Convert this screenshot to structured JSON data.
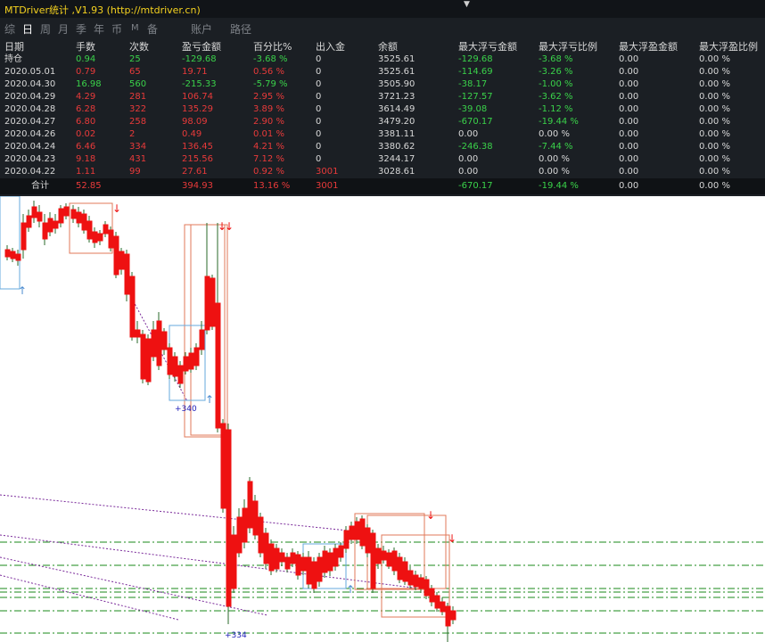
{
  "title": "MTDriver统计 ,V1.93 (http://mtdriver.cn)",
  "nav": {
    "tabs": [
      {
        "label": "综",
        "active": false
      },
      {
        "label": "日",
        "active": true
      },
      {
        "label": "周",
        "active": false
      },
      {
        "label": "月",
        "active": false
      },
      {
        "label": "季",
        "active": false
      },
      {
        "label": "年",
        "active": false
      },
      {
        "label": "币",
        "active": false
      },
      {
        "label": "M",
        "active": false
      },
      {
        "label": "备",
        "active": false
      },
      {
        "label": "账户",
        "active": false
      },
      {
        "label": "路径",
        "active": false
      }
    ]
  },
  "table": {
    "headers": [
      "日期",
      "手数",
      "次数",
      "盈亏金额",
      "百分比%",
      "出入金",
      "余额",
      "最大浮亏金额",
      "最大浮亏比例",
      "最大浮盈金额",
      "最大浮盈比例"
    ],
    "rows": [
      {
        "cells": [
          "持仓",
          "0.94",
          "25",
          "-129.68",
          "-3.68 %",
          "0",
          "3525.61",
          "-129.68",
          "-3.68 %",
          "0.00",
          "0.00 %"
        ],
        "tone": "g"
      },
      {
        "cells": [
          "2020.05.01",
          "0.79",
          "65",
          "19.71",
          "0.56 %",
          "0",
          "3525.61",
          "-114.69",
          "-3.26 %",
          "0.00",
          "0.00 %"
        ],
        "tone": "r"
      },
      {
        "cells": [
          "2020.04.30",
          "16.98",
          "560",
          "-215.33",
          "-5.79 %",
          "0",
          "3505.90",
          "-38.17",
          "-1.00 %",
          "0.00",
          "0.00 %"
        ],
        "tone": "g"
      },
      {
        "cells": [
          "2020.04.29",
          "4.29",
          "281",
          "106.74",
          "2.95 %",
          "0",
          "3721.23",
          "-127.57",
          "-3.62 %",
          "0.00",
          "0.00 %"
        ],
        "tone": "r"
      },
      {
        "cells": [
          "2020.04.28",
          "6.28",
          "322",
          "135.29",
          "3.89 %",
          "0",
          "3614.49",
          "-39.08",
          "-1.12 %",
          "0.00",
          "0.00 %"
        ],
        "tone": "r"
      },
      {
        "cells": [
          "2020.04.27",
          "6.80",
          "258",
          "98.09",
          "2.90 %",
          "0",
          "3479.20",
          "-670.17",
          "-19.44 %",
          "0.00",
          "0.00 %"
        ],
        "tone": "r"
      },
      {
        "cells": [
          "2020.04.26",
          "0.02",
          "2",
          "0.49",
          "0.01 %",
          "0",
          "3381.11",
          "0.00",
          "0.00 %",
          "0.00",
          "0.00 %"
        ],
        "tone": "r"
      },
      {
        "cells": [
          "2020.04.24",
          "6.46",
          "334",
          "136.45",
          "4.21 %",
          "0",
          "3380.62",
          "-246.38",
          "-7.44 %",
          "0.00",
          "0.00 %"
        ],
        "tone": "r"
      },
      {
        "cells": [
          "2020.04.23",
          "9.18",
          "431",
          "215.56",
          "7.12 %",
          "0",
          "3244.17",
          "0.00",
          "0.00 %",
          "0.00",
          "0.00 %"
        ],
        "tone": "r"
      },
      {
        "cells": [
          "2020.04.22",
          "1.11",
          "99",
          "27.61",
          "0.92 %",
          "3001",
          "3028.61",
          "0.00",
          "0.00 %",
          "0.00",
          "0.00 %"
        ],
        "tone": "r"
      }
    ],
    "total": {
      "label": "合计",
      "lots": "52.85",
      "count": "",
      "pnl": "394.93",
      "pct": "13.16 %",
      "flow": "3001",
      "balance": "",
      "max_dd": "-670.17",
      "max_dd_pct": "-19.44 %",
      "max_fp": "0.00",
      "max_fp_pct": "0.00 %"
    }
  },
  "chart_annotations": [
    "+340",
    "+334"
  ],
  "colors": {
    "bull": "#1f7a1f",
    "bear": "#ee1111",
    "box": "#e0785a",
    "box_blue": "#66aadd",
    "level": "#1a8a1a",
    "trend": "#7a2a9a"
  }
}
